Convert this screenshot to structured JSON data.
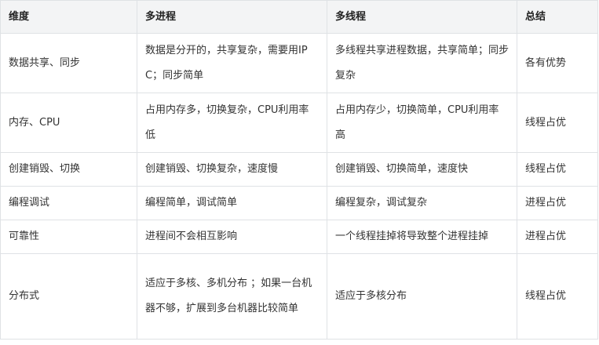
{
  "table": {
    "headers": [
      "维度",
      "多进程",
      "多线程",
      "总结"
    ],
    "rows": [
      [
        "数据共享、同步",
        "数据是分开的，共享复杂，需要用IPC；同步简单",
        "多线程共享进程数据，共享简单；同步复杂",
        "各有优势"
      ],
      [
        "内存、CPU",
        "占用内存多，切换复杂，CPU利用率低",
        "占用内存少，切换简单，CPU利用率高",
        "线程占优"
      ],
      [
        "创建销毁、切换",
        "创建销毁、切换复杂，速度慢",
        "创建销毁、切换简单，速度快",
        "线程占优"
      ],
      [
        "编程调试",
        "编程简单，调试简单",
        "编程复杂，调试复杂",
        "进程占优"
      ],
      [
        "可靠性",
        "进程间不会相互影响",
        "一个线程挂掉将导致整个进程挂掉",
        "进程占优"
      ],
      [
        "分布式",
        "适应于多核、多机分布 ；如果一台机器不够，扩展到多台机器比较简单",
        "适应于多核分布",
        "线程占优"
      ]
    ]
  }
}
